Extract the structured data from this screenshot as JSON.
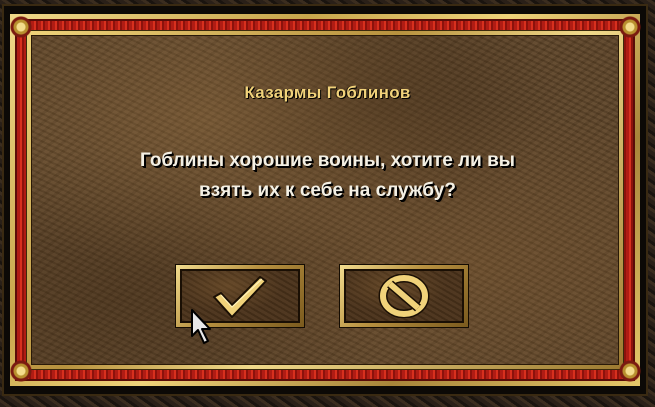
{
  "dialog": {
    "title": "Казармы Гоблинов",
    "message_lines": [
      "Гоблины хорошие воины, хотите ли вы",
      "взять их к себе на службу?"
    ]
  },
  "buttons": {
    "ok_icon": "checkmark-icon",
    "cancel_icon": "cancel-circle-icon"
  },
  "colors": {
    "title": "#f1d27a",
    "message": "#f4f0e4",
    "icon_gold": "#f0d27a",
    "frame_red": "#b01c14"
  }
}
